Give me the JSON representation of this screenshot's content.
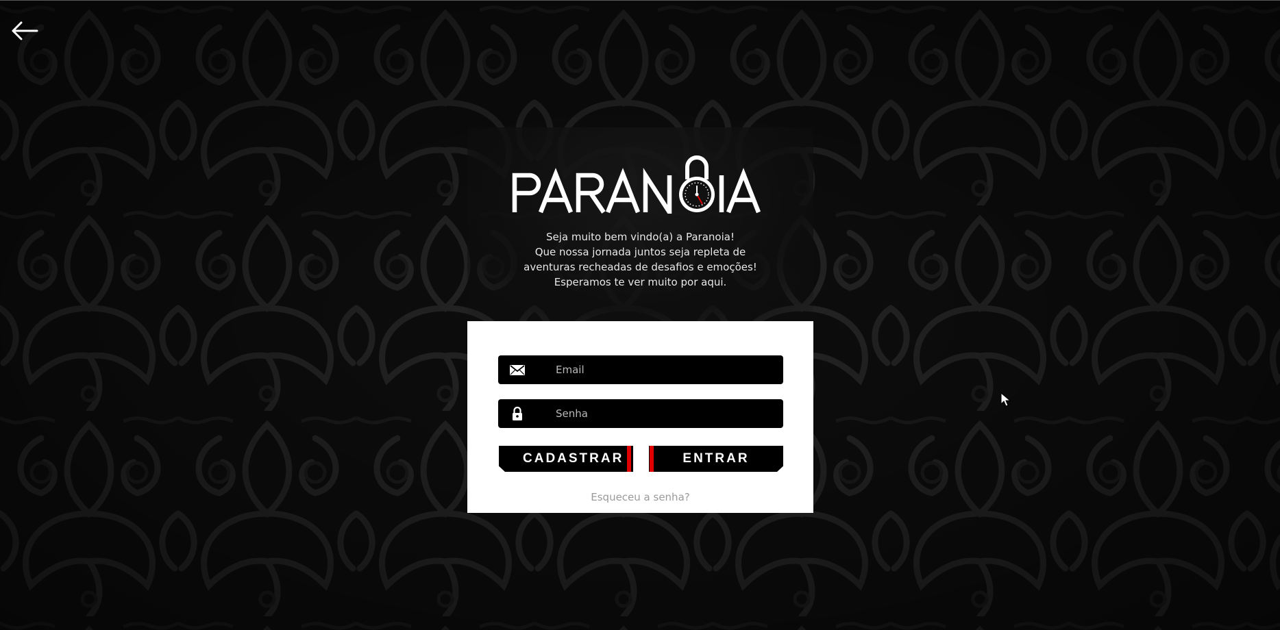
{
  "page": {
    "background_color": "#0d0d0d",
    "accent_color": "#e00000"
  },
  "nav": {
    "back_icon": "arrow-left-icon"
  },
  "brand": {
    "logo_text": "PARANOIA",
    "logo_icon": "padlock-clock-icon"
  },
  "welcome": {
    "lines": [
      "Seja muito bem vindo(a) a Paranoia!",
      "Que nossa jornada juntos seja repleta de",
      "aventuras recheadas de desafios e emoções!",
      "Esperamos te ver muito por aqui."
    ]
  },
  "form": {
    "email": {
      "icon": "envelope-icon",
      "placeholder": "Email",
      "value": ""
    },
    "password": {
      "icon": "lock-icon",
      "placeholder": "Senha",
      "value": ""
    },
    "register_label": "CADASTRAR",
    "login_label": "ENTRAR",
    "forgot_label": "Esqueceu a senha?"
  }
}
